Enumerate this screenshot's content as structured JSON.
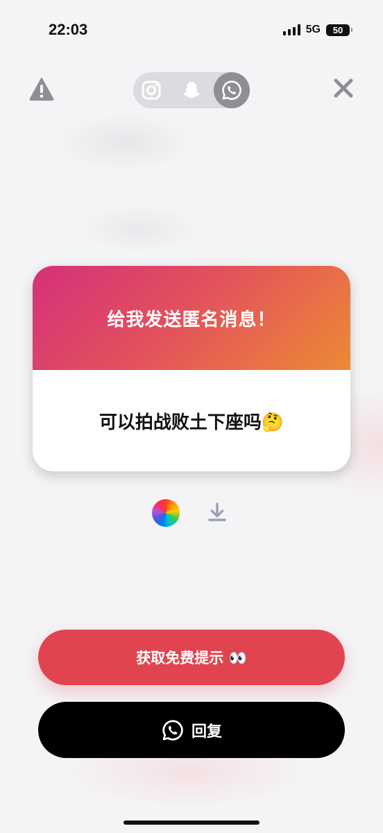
{
  "status_bar": {
    "time": "22:03",
    "network": "5G",
    "battery": "50"
  },
  "top_bar": {
    "share_targets": [
      "instagram",
      "snapchat",
      "whatsapp"
    ],
    "active_target": "whatsapp"
  },
  "card": {
    "title": "给我发送匿名消息！",
    "message": "可以拍战败土下座吗🤔"
  },
  "buttons": {
    "hint_label": "获取免费提示 👀",
    "reply_label": "回复"
  },
  "colors": {
    "accent_red": "#e0454f",
    "gradient_start": "#d5307a",
    "gradient_end": "#ec8a34",
    "reply_bg": "#000000"
  },
  "icons": {
    "warning": "warning-icon",
    "close": "close-icon",
    "instagram": "instagram-icon",
    "snapchat": "snapchat-icon",
    "whatsapp": "whatsapp-icon",
    "color_picker": "color-wheel-icon",
    "download": "download-icon"
  }
}
